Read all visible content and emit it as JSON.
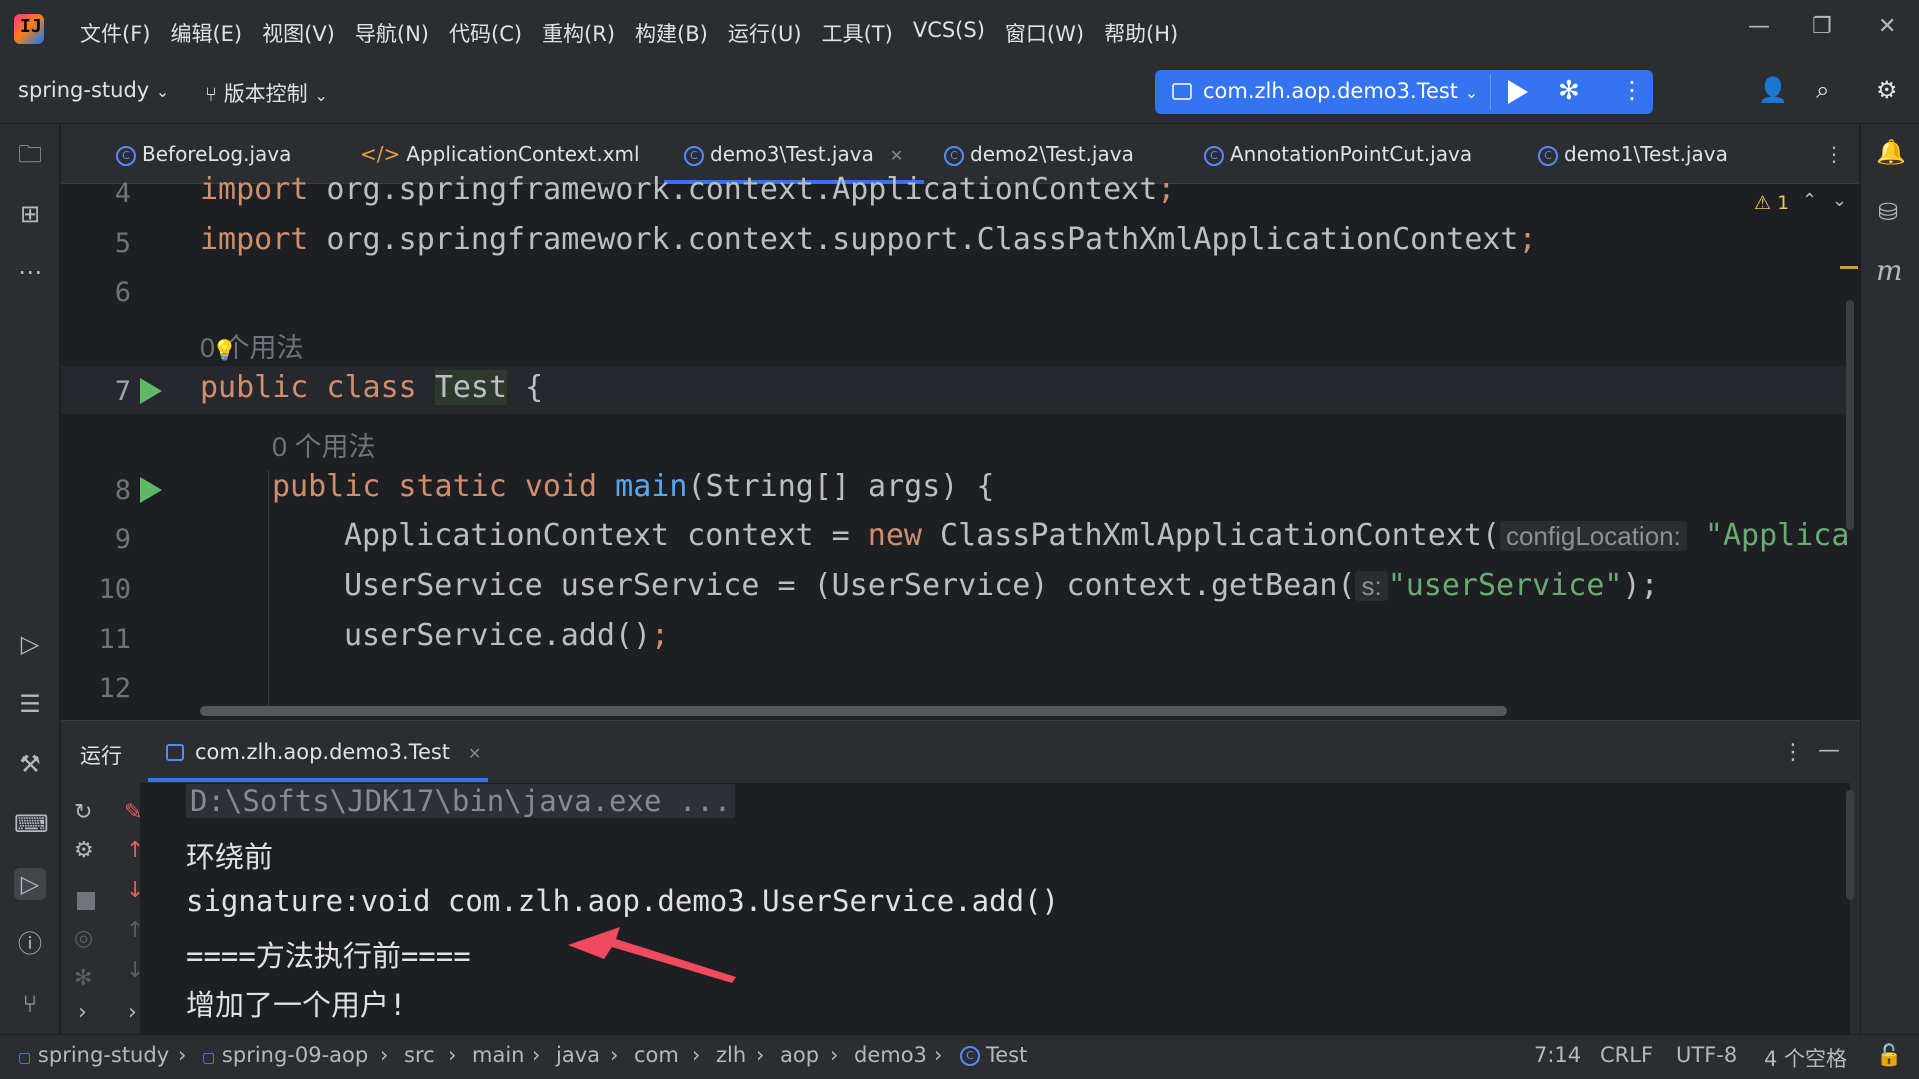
{
  "menu": [
    "文件(F)",
    "编辑(E)",
    "视图(V)",
    "导航(N)",
    "代码(C)",
    "重构(R)",
    "构建(B)",
    "运行(U)",
    "工具(T)",
    "VCS(S)",
    "窗口(W)",
    "帮助(H)"
  ],
  "toolbar": {
    "project": "spring-study",
    "vcs": "版本控制",
    "run_config": "com.zlh.aop.demo3.Test"
  },
  "tabs": [
    {
      "label": "BeforeLog.java"
    },
    {
      "label": "ApplicationContext.xml"
    },
    {
      "label": "demo3\\Test.java",
      "active": true
    },
    {
      "label": "demo2\\Test.java"
    },
    {
      "label": "AnnotationPointCut.java"
    },
    {
      "label": "demo1\\Test.java"
    }
  ],
  "editor": {
    "warnings": "1",
    "lines": [
      {
        "no": "4",
        "text": "import org.springframework.context.ApplicationContext;"
      },
      {
        "no": "5",
        "text": "import org.springframework.context.support.ClassPathXmlApplicationContext;"
      },
      {
        "no": "6",
        "text": ""
      },
      {
        "no": "",
        "text": "0 个用法"
      },
      {
        "no": "7",
        "text": "public class Test {"
      },
      {
        "no": "",
        "text": "0 个用法"
      },
      {
        "no": "8",
        "text": "public static void main(String[] args) {"
      },
      {
        "no": "9",
        "text": "ApplicationContext context = new ClassPathXmlApplicationContext("
      },
      {
        "no": "10",
        "text": "UserService userService = (UserService) context.getBean("
      },
      {
        "no": "11",
        "text": "userService.add();"
      },
      {
        "no": "12",
        "text": ""
      }
    ],
    "inlay_config": "configLocation:",
    "inlay_s": "s:",
    "str_applica": "\"Applica",
    "str_userservice": "\"userService\"",
    "tail_10": ");"
  },
  "run": {
    "header": "运行",
    "tab": "com.zlh.aop.demo3.Test",
    "output": [
      "D:\\Softs\\JDK17\\bin\\java.exe ...",
      "环绕前",
      "signature:void com.zlh.aop.demo3.UserService.add()",
      "====方法执行前====",
      "增加了一个用户!"
    ],
    "arrow_color": "#ef4a5f"
  },
  "breadcrumb": [
    "spring-study",
    "spring-09-aop",
    "src",
    "main",
    "java",
    "com",
    "zlh",
    "aop",
    "demo3",
    "Test"
  ],
  "status": {
    "position": "7:14",
    "line_sep": "CRLF",
    "encoding": "UTF-8",
    "indent": "4 个空格"
  }
}
